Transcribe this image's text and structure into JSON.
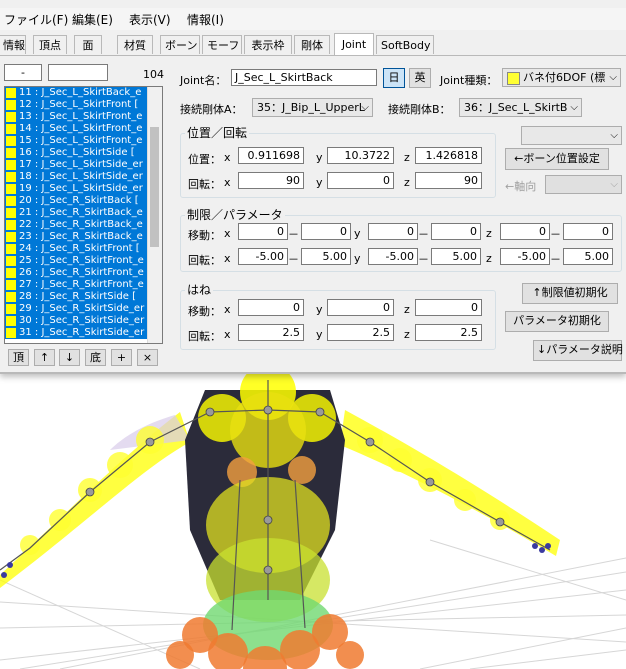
{
  "menu": [
    "ファイル(F)",
    "編集(E)",
    "表示(V)",
    "情報(I)"
  ],
  "tabs": [
    "情報",
    "頂点",
    "面",
    "材質",
    "ボーン",
    "モーフ",
    "表示枠",
    "剛体",
    "Joint",
    "SoftBody"
  ],
  "active_tab": "Joint",
  "list_panel": {
    "spinner_value": "-",
    "filter_value": "",
    "count": "104",
    "items": [
      "11 : J_Sec_L_SkirtBack_e",
      "12 : J_Sec_L_SkirtFront [",
      "13 : J_Sec_L_SkirtFront_e",
      "14 : J_Sec_L_SkirtFront_e",
      "15 : J_Sec_L_SkirtFront_e",
      "16 : J_Sec_L_SkirtSide [",
      "17 : J_Sec_L_SkirtSide_er",
      "18 : J_Sec_L_SkirtSide_er",
      "19 : J_Sec_L_SkirtSide_er",
      "20 : J_Sec_R_SkirtBack [",
      "21 : J_Sec_R_SkirtBack_e",
      "22 : J_Sec_R_SkirtBack_e",
      "23 : J_Sec_R_SkirtBack_e",
      "24 : J_Sec_R_SkirtFront [",
      "25 : J_Sec_R_SkirtFront_e",
      "26 : J_Sec_R_SkirtFront_e",
      "27 : J_Sec_R_SkirtFront_e",
      "28 : J_Sec_R_SkirtSide [",
      "29 : J_Sec_R_SkirtSide_er",
      "30 : J_Sec_R_SkirtSide_er",
      "31 : J_Sec_R_SkirtSide_er"
    ],
    "swatch_color": "#ffff00",
    "selection_color": "#0078d7",
    "buttons": [
      "頂",
      "↑",
      "↓",
      "底",
      "+",
      "×"
    ]
  },
  "joint": {
    "name_label": "Joint名：",
    "name_value": "J_Sec_L_SkirtBack",
    "lang_jp": "日",
    "lang_en": "英",
    "type_label": "Joint種類：",
    "type_value": "バネ付6DOF (標",
    "type_swatch": "#ffff33",
    "body_a_label": "接続剛体A：",
    "body_a_value": "35：J_Bip_L_UpperL",
    "body_b_label": "接続剛体B：",
    "body_b_value": "36：J_Sec_L_SkirtB"
  },
  "position": {
    "title": "位置／回転",
    "pos_label": "位置：",
    "rot_label": "回転：",
    "x": "x",
    "y": "y",
    "z": "z",
    "pos": [
      "0.911698",
      "10.3722",
      "1.426818"
    ],
    "rot": [
      "90",
      "0",
      "90"
    ],
    "bone_pos_button": "←ボーン位置設定",
    "axis_label": "←軸向",
    "top_dropdown": ""
  },
  "limits": {
    "title": "制限／パラメータ",
    "move_label": "移動：",
    "rot_label": "回転：",
    "move": [
      [
        "0",
        "0"
      ],
      [
        "0",
        "0"
      ],
      [
        "0",
        "0"
      ]
    ],
    "rot": [
      [
        "-5.00",
        "5.00"
      ],
      [
        "-5.00",
        "5.00"
      ],
      [
        "-5.00",
        "5.00"
      ]
    ],
    "dash": "－"
  },
  "spring": {
    "title": "はね",
    "move_label": "移動：",
    "rot_label": "回転：",
    "move": [
      "0",
      "0",
      "0"
    ],
    "rot": [
      "2.5",
      "2.5",
      "2.5"
    ]
  },
  "buttons": {
    "reset_limits": "↑制限値初期化",
    "reset_params": "パラメータ初期化",
    "param_help": "↓パラメータ説明"
  }
}
